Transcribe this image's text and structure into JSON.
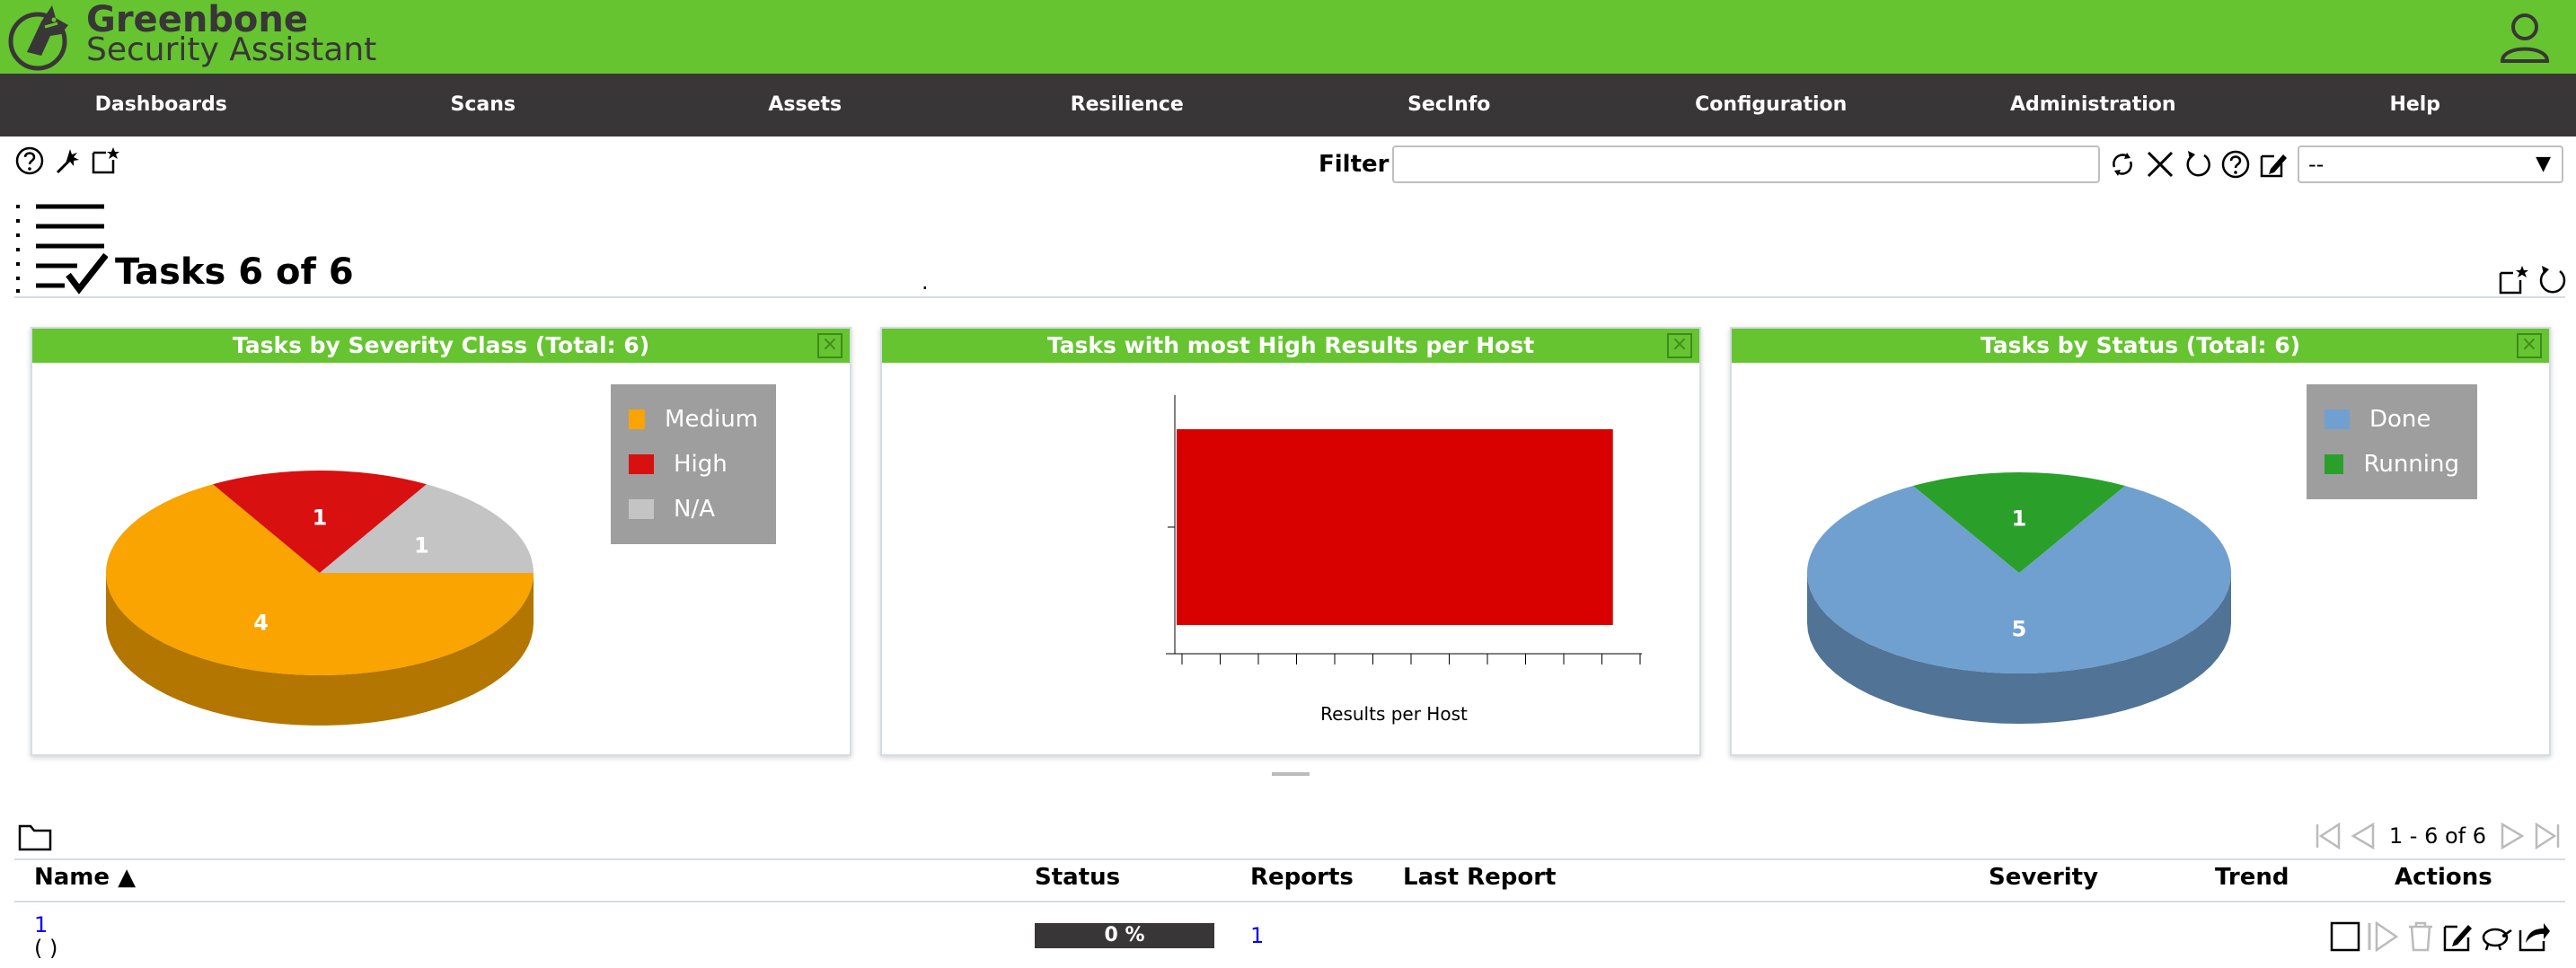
{
  "header": {
    "brand_line1": "Greenbone",
    "brand_line2": "Security Assistant"
  },
  "nav": {
    "items": [
      "Dashboards",
      "Scans",
      "Assets",
      "Resilience",
      "SecInfo",
      "Configuration",
      "Administration",
      "Help"
    ]
  },
  "toolbar": {
    "filter_label": "Filter",
    "filter_value": "",
    "filter_select_value": "--"
  },
  "page": {
    "title": "Tasks 6 of 6",
    "dot": "."
  },
  "panels": {
    "severity": {
      "title": "Tasks by Severity Class (Total: 6)",
      "close": "×",
      "legend": [
        "Medium",
        "High",
        "N/A"
      ]
    },
    "high_results": {
      "title": "Tasks with most High Results per Host",
      "close": "×"
    },
    "status": {
      "title": "Tasks by Status (Total: 6)",
      "close": "×",
      "legend": [
        "Done",
        "Running"
      ]
    }
  },
  "chart_data": [
    {
      "type": "pie",
      "title": "Tasks by Severity Class (Total: 6)",
      "labels": [
        "Medium",
        "High",
        "N/A"
      ],
      "values": [
        4,
        1,
        1
      ],
      "colors": [
        "#f9a400",
        "#d91010",
        "#c4c4c4"
      ],
      "legend_position": "top-right"
    },
    {
      "type": "bar",
      "title": "Tasks with most High Results per Host",
      "orientation": "horizontal",
      "categories": [
        ""
      ],
      "values": [
        1
      ],
      "xlabel": "Results per Host",
      "color": "#d90000"
    },
    {
      "type": "pie",
      "title": "Tasks by Status (Total: 6)",
      "labels": [
        "Done",
        "Running"
      ],
      "values": [
        5,
        1
      ],
      "colors": [
        "#70a0d0",
        "#2aa02a"
      ],
      "legend_position": "top-right"
    }
  ],
  "table": {
    "pager_text": "1 - 6 of 6",
    "columns": {
      "name": "Name ▲",
      "status": "Status",
      "reports": "Reports",
      "last_report": "Last Report",
      "severity": "Severity",
      "trend": "Trend",
      "actions": "Actions"
    },
    "rows": [
      {
        "name": "1",
        "comment": "(          )",
        "status": "0 %",
        "progress": 0,
        "reports": "1"
      }
    ]
  },
  "colors": {
    "brand_green": "#66c430",
    "nav_dark": "#393637"
  }
}
